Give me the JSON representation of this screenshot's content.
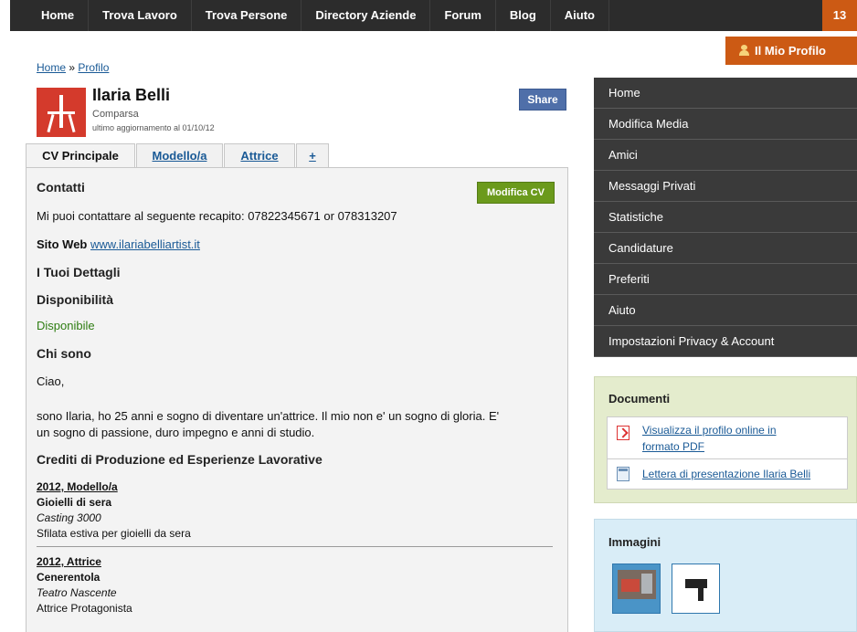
{
  "topnav": {
    "items": [
      "Home",
      "Trova Lavoro",
      "Trova Persone",
      "Directory Aziende",
      "Forum",
      "Blog",
      "Aiuto"
    ],
    "badge": "13"
  },
  "profile_button": "Il Mio Profilo",
  "breadcrumb": {
    "home": "Home",
    "sep": "»",
    "current": "Profilo"
  },
  "profile": {
    "name": "Ilaria Belli",
    "role": "Comparsa",
    "updated": "ultimo aggiornamento al 01/10/12",
    "share": "Share"
  },
  "tabs": [
    "CV Principale",
    "Modello/a",
    "Attrice",
    "+"
  ],
  "cv": {
    "edit_button": "Modifica CV",
    "contacts_heading": "Contatti",
    "contacts_text": "Mi puoi contattare al seguente recapito: 07822345671 or 078313207",
    "website_label": "Sito Web",
    "website_url": "www.ilariabelliartist.it",
    "details_heading": "I Tuoi Dettagli",
    "availability_heading": "Disponibilità",
    "availability_value": "Disponibile",
    "about_heading": "Chi sono",
    "about_greeting": "Ciao,",
    "about_line1": "sono Ilaria, ho 25 anni e sogno di diventare un'attrice. Il mio non e' un sogno di gloria. E'",
    "about_line2": "un sogno di passione, duro impegno e anni di studio.",
    "credits_heading": "Crediti di Produzione ed Esperienze Lavorative",
    "credits": [
      {
        "year": "2012, Modello/a",
        "title": "Gioielli di sera",
        "company": "Casting 3000",
        "desc": "Sfilata estiva per gioielli da sera"
      },
      {
        "year": "2012, Attrice",
        "title": "Cenerentola",
        "company": "Teatro Nascente",
        "desc": "Attrice Protagonista"
      }
    ]
  },
  "sidebar": {
    "menu": [
      "Home",
      "Modifica Media",
      "Amici",
      "Messaggi Privati",
      "Statistiche",
      "Candidature",
      "Preferiti",
      "Aiuto",
      "Impostazioni Privacy & Account"
    ],
    "documents_title": "Documenti",
    "documents": [
      {
        "line1": "Visualizza il profilo online in",
        "line2": "formato PDF",
        "icon": "pdf-icon"
      },
      {
        "line1": "Lettera di presentazione Ilaria Belli",
        "icon": "document-icon"
      }
    ],
    "images_title": "Immagini"
  }
}
